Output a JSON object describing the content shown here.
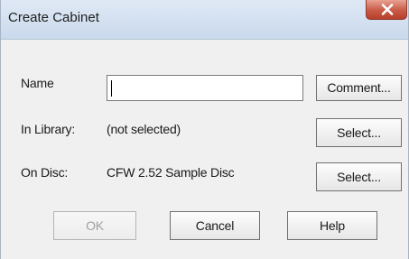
{
  "window": {
    "title": "Create Cabinet"
  },
  "form": {
    "name_label": "Name",
    "name_value": "",
    "comment_button": "Comment...",
    "library_label": "In Library:",
    "library_value": "(not selected)",
    "library_select_button": "Select...",
    "disc_label": "On Disc:",
    "disc_value": "CFW 2.52 Sample Disc",
    "disc_select_button": "Select..."
  },
  "buttons": {
    "ok": "OK",
    "cancel": "Cancel",
    "help": "Help"
  },
  "icons": {
    "close": "close-icon"
  },
  "colors": {
    "close_button": "#c85a46",
    "dialog_background": "#f0f0f0",
    "titlebar": "#dfe9f5",
    "disabled_text": "#a0a0a0"
  }
}
